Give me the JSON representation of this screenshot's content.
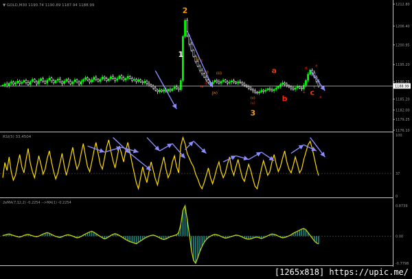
{
  "colors": {
    "background": "#000000",
    "separator": "#c8c8c8",
    "grid": "#1e1e1e",
    "price_line": "#c8c8c8",
    "candle_up": "#00ff00",
    "candle_down": "#ffffff",
    "rsi_line": "#ffdd00",
    "macd_line": "#c8d200",
    "macd_hist": "#1f8f86",
    "drawing": "#8c8cff",
    "wave_orange": "#ff9900",
    "wave_red": "#ff2a00",
    "text_gray": "#9a9a9a"
  },
  "header_text": "▼ GOLD,M30  1190.74 1190.89 1187.94 1188.99",
  "overlay_tag": "[1265x818] https://upic.me/",
  "chart_data": [
    {
      "type": "candlestick",
      "title": "GOLD,M30",
      "axis_labels": [
        "1212.80",
        "1206.40",
        "1200.95",
        "1195.20",
        "1190.25",
        "1185.20",
        "1182.00",
        "1179.25",
        "1176.10"
      ],
      "price_level_label": "1188.99",
      "ylim": [
        1176.1,
        1212.8
      ],
      "last_price": 1188.99,
      "ohlc_last": {
        "open": 1190.74,
        "high": 1190.89,
        "low": 1187.94,
        "close": 1188.99
      },
      "close": [
        1189.2,
        1189.6,
        1189.0,
        1189.8,
        1190.2,
        1189.5,
        1189.9,
        1190.4,
        1189.7,
        1190.1,
        1190.6,
        1190.0,
        1189.4,
        1190.3,
        1190.9,
        1190.2,
        1189.6,
        1190.5,
        1191.1,
        1190.4,
        1189.8,
        1190.7,
        1191.3,
        1190.5,
        1189.9,
        1190.6,
        1191.0,
        1190.2,
        1189.7,
        1190.4,
        1190.9,
        1190.3,
        1189.6,
        1190.2,
        1190.8,
        1190.1,
        1189.5,
        1190.3,
        1190.9,
        1191.4,
        1190.7,
        1190.1,
        1190.8,
        1191.5,
        1190.9,
        1190.3,
        1190.9,
        1191.6,
        1191.1,
        1190.5,
        1191.0,
        1191.7,
        1191.2,
        1190.6,
        1191.1,
        1191.9,
        1191.3,
        1190.7,
        1191.2,
        1191.8,
        1191.2,
        1190.6,
        1190.9,
        1190.3,
        1190.8,
        1190.2,
        1189.9,
        1190.4,
        1189.8,
        1189.3,
        1188.9,
        1188.4,
        1187.8,
        1187.3,
        1187.8,
        1187.4,
        1187.9,
        1187.5,
        1188.0,
        1187.6,
        1188.2,
        1188.7,
        1188.3,
        1187.9,
        1190.6,
        1203.4,
        1208.1,
        1203.6,
        1201.2,
        1199.4,
        1197.6,
        1196.1,
        1194.8,
        1193.6,
        1192.5,
        1191.6,
        1190.7,
        1190.0,
        1189.5,
        1190.1,
        1190.6,
        1190.2,
        1189.8,
        1190.3,
        1190.7,
        1190.2,
        1189.8,
        1190.1,
        1190.5,
        1190.1,
        1189.8,
        1190.2,
        1190.0,
        1189.6,
        1189.2,
        1188.8,
        1188.4,
        1188.0,
        1187.6,
        1187.2,
        1186.9,
        1187.3,
        1187.7,
        1187.4,
        1187.8,
        1188.2,
        1187.9,
        1187.6,
        1188.0,
        1188.4,
        1188.8,
        1189.4,
        1189.9,
        1189.5,
        1189.1,
        1188.7,
        1188.3,
        1188.0,
        1188.4,
        1188.8,
        1188.4,
        1188.1,
        1189.2,
        1190.6,
        1192.4,
        1193.6,
        1192.8,
        1191.6,
        1190.4,
        1188.99
      ],
      "wave_labels": [
        {
          "text": "2",
          "i": 86,
          "price": 1210.2,
          "color": "orange"
        },
        {
          "text": "1",
          "i": 84,
          "price": 1197.4,
          "color": "white"
        },
        {
          "text": "3",
          "i": 118,
          "price": 1180.4,
          "color": "orange"
        },
        {
          "text": "a",
          "i": 128,
          "price": 1192.8,
          "color": "red"
        },
        {
          "text": "b",
          "i": 133,
          "price": 1184.6,
          "color": "red"
        },
        {
          "text": "c",
          "i": 146,
          "price": 1186.4,
          "color": "red"
        }
      ],
      "wave_sublabels": [
        {
          "text": "(i)",
          "i": 92,
          "price": 1196.6,
          "color": "orange"
        },
        {
          "text": "(ii)",
          "i": 96,
          "price": 1192.7,
          "color": "orange"
        },
        {
          "text": "(iii)",
          "i": 102,
          "price": 1192.4,
          "color": "orange"
        },
        {
          "text": "(iv)",
          "i": 100,
          "price": 1186.7,
          "color": "orange"
        },
        {
          "text": "(v)",
          "i": 118,
          "price": 1185.2,
          "color": "orange"
        },
        {
          "text": "(v)",
          "i": 118,
          "price": 1183.7,
          "color": "red"
        },
        {
          "text": "i",
          "i": 88,
          "price": 1199.9,
          "color": "red"
        },
        {
          "text": "ii",
          "i": 94,
          "price": 1196.0,
          "color": "red"
        },
        {
          "text": "iii",
          "i": 96,
          "price": 1189.4,
          "color": "red"
        },
        {
          "text": "iv",
          "i": 94,
          "price": 1188.5,
          "color": "red"
        },
        {
          "text": "v",
          "i": 99,
          "price": 1186.2,
          "color": "red"
        },
        {
          "text": "d",
          "i": 143,
          "price": 1193.9,
          "color": "red"
        },
        {
          "text": "e",
          "i": 148,
          "price": 1194.5,
          "color": "red"
        },
        {
          "text": "b",
          "i": 146,
          "price": 1191.9,
          "color": "gray"
        },
        {
          "text": "c",
          "i": 147,
          "price": 1188.4,
          "color": "gray"
        },
        {
          "text": "a",
          "i": 142,
          "price": 1186.9,
          "color": "red"
        },
        {
          "text": "e",
          "i": 150,
          "price": 1185.5,
          "color": "red"
        }
      ],
      "arrows": [
        {
          "i1": 72,
          "p1": 1193.4,
          "i2": 82,
          "p2": 1182.3
        },
        {
          "i1": 87,
          "p1": 1205.0,
          "i2": 99,
          "p2": 1188.6
        },
        {
          "i1": 145,
          "p1": 1193.6,
          "i2": 152,
          "p2": 1187.6
        }
      ]
    },
    {
      "type": "line",
      "title": "RSI(5) 33.4504",
      "axis_labels": [
        "100",
        "37",
        "0"
      ],
      "level": 37,
      "ylim": [
        0,
        100
      ],
      "values": [
        30,
        55,
        42,
        64,
        40,
        26,
        34,
        52,
        68,
        48,
        38,
        60,
        78,
        54,
        40,
        30,
        48,
        66,
        52,
        36,
        44,
        62,
        74,
        56,
        40,
        28,
        38,
        54,
        70,
        50,
        34,
        48,
        64,
        80,
        60,
        44,
        52,
        70,
        86,
        66,
        48,
        40,
        56,
        74,
        88,
        70,
        52,
        44,
        62,
        80,
        92,
        74,
        58,
        46,
        64,
        82,
        70,
        56,
        74,
        88,
        72,
        54,
        38,
        22,
        12,
        30,
        48,
        34,
        22,
        40,
        56,
        42,
        28,
        18,
        36,
        50,
        64,
        44,
        30,
        38,
        56,
        66,
        48,
        38,
        82,
        96,
        86,
        70,
        62,
        54,
        48,
        36,
        28,
        18,
        12,
        22,
        34,
        46,
        30,
        20,
        32,
        46,
        56,
        40,
        30,
        38,
        52,
        64,
        44,
        34,
        48,
        60,
        44,
        30,
        24,
        38,
        52,
        42,
        28,
        16,
        12,
        28,
        44,
        58,
        46,
        34,
        40,
        56,
        68,
        52,
        40,
        48,
        62,
        74,
        56,
        44,
        38,
        50,
        64,
        52,
        38,
        44,
        60,
        72,
        84,
        90,
        78,
        62,
        46,
        33.45
      ],
      "arrows": [
        {
          "i1": 40,
          "v1": 82,
          "i2": 48,
          "v2": 72
        },
        {
          "i1": 48,
          "v1": 72,
          "i2": 56,
          "v2": 80
        },
        {
          "i1": 52,
          "v1": 96,
          "i2": 60,
          "v2": 70
        },
        {
          "i1": 56,
          "v1": 80,
          "i2": 64,
          "v2": 72
        },
        {
          "i1": 60,
          "v1": 70,
          "i2": 70,
          "v2": 42
        },
        {
          "i1": 68,
          "v1": 96,
          "i2": 74,
          "v2": 74
        },
        {
          "i1": 74,
          "v1": 74,
          "i2": 80,
          "v2": 86
        },
        {
          "i1": 80,
          "v1": 86,
          "i2": 86,
          "v2": 62
        },
        {
          "i1": 86,
          "v1": 76,
          "i2": 90,
          "v2": 90
        },
        {
          "i1": 90,
          "v1": 90,
          "i2": 96,
          "v2": 70
        },
        {
          "i1": 104,
          "v1": 56,
          "i2": 110,
          "v2": 66
        },
        {
          "i1": 110,
          "v1": 66,
          "i2": 116,
          "v2": 60
        },
        {
          "i1": 116,
          "v1": 60,
          "i2": 122,
          "v2": 72
        },
        {
          "i1": 122,
          "v1": 72,
          "i2": 128,
          "v2": 58
        },
        {
          "i1": 136,
          "v1": 70,
          "i2": 142,
          "v2": 84
        },
        {
          "i1": 142,
          "v1": 84,
          "i2": 148,
          "v2": 74
        },
        {
          "i1": 145,
          "v1": 96,
          "i2": 152,
          "v2": 64
        }
      ]
    },
    {
      "type": "line",
      "title": "2eMA(7,12,2) -0.2254 -->MA(1) -0.2254",
      "axis_labels": [
        "0.8739",
        "0.00",
        "-0.7798"
      ],
      "ylim": [
        -0.7798,
        0.8739
      ],
      "zero_level": 0.0,
      "values": [
        0.02,
        0.03,
        0.05,
        0.06,
        0.04,
        0.02,
        0.0,
        -0.02,
        -0.03,
        -0.01,
        0.02,
        0.04,
        0.05,
        0.03,
        0.01,
        -0.01,
        -0.02,
        0.0,
        0.03,
        0.06,
        0.08,
        0.1,
        0.08,
        0.05,
        0.02,
        -0.01,
        -0.03,
        -0.04,
        -0.02,
        0.01,
        0.03,
        0.04,
        0.02,
        0.0,
        -0.03,
        -0.05,
        -0.04,
        -0.01,
        0.03,
        0.06,
        0.09,
        0.12,
        0.14,
        0.11,
        0.07,
        0.03,
        -0.01,
        -0.05,
        -0.08,
        -0.06,
        -0.02,
        0.02,
        0.05,
        0.07,
        0.05,
        0.02,
        -0.02,
        -0.06,
        -0.1,
        -0.13,
        -0.16,
        -0.18,
        -0.2,
        -0.22,
        -0.18,
        -0.14,
        -0.1,
        -0.06,
        -0.03,
        0.0,
        0.02,
        0.03,
        0.01,
        -0.02,
        -0.05,
        -0.08,
        -0.1,
        -0.08,
        -0.05,
        -0.02,
        0.0,
        0.02,
        0.04,
        0.1,
        0.34,
        0.74,
        0.87,
        0.48,
        0.06,
        -0.42,
        -0.7,
        -0.78,
        -0.62,
        -0.44,
        -0.3,
        -0.18,
        -0.1,
        -0.04,
        0.0,
        0.03,
        0.05,
        0.04,
        0.02,
        -0.01,
        -0.04,
        -0.06,
        -0.05,
        -0.03,
        -0.01,
        0.01,
        0.03,
        0.02,
        0.0,
        -0.03,
        -0.06,
        -0.08,
        -0.09,
        -0.08,
        -0.06,
        -0.04,
        -0.03,
        -0.05,
        -0.07,
        -0.05,
        -0.02,
        0.01,
        0.04,
        0.06,
        0.05,
        0.03,
        0.0,
        -0.03,
        -0.05,
        -0.04,
        -0.02,
        0.01,
        0.04,
        0.08,
        0.11,
        0.14,
        0.17,
        0.2,
        0.22,
        0.18,
        0.1,
        0.02,
        -0.06,
        -0.14,
        -0.2,
        -0.2254
      ]
    }
  ]
}
